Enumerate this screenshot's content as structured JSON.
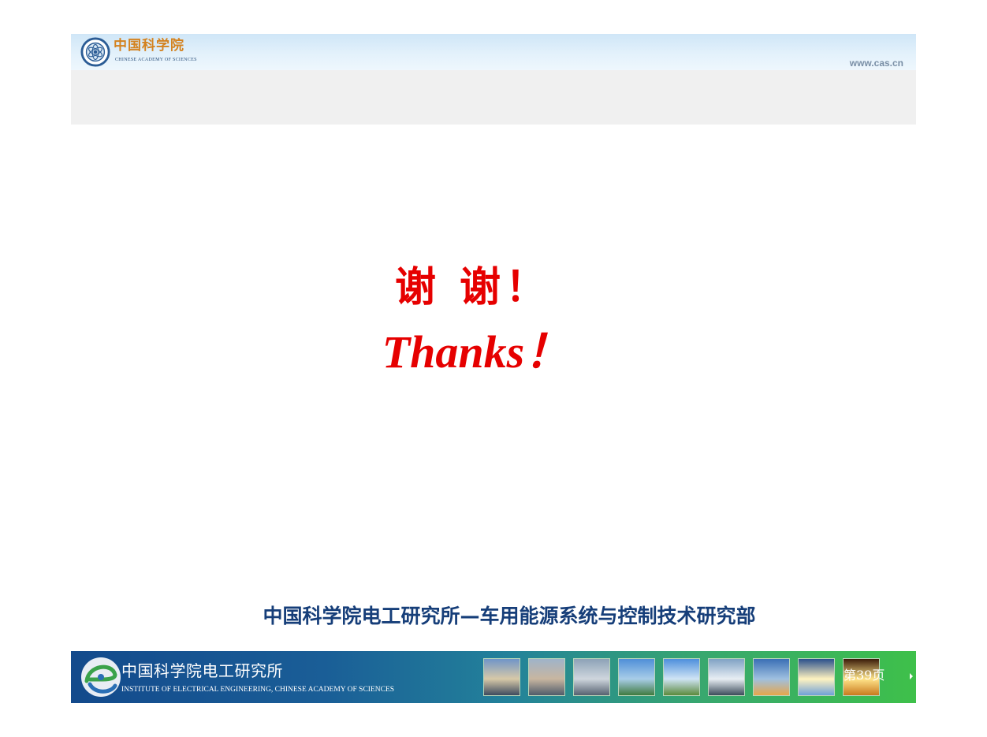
{
  "header": {
    "org_name_cn": "中国科学院",
    "org_name_en": "CHINESE ACADEMY OF SCIENCES",
    "url": "www.cas.cn"
  },
  "slide": {
    "thanks_cn": "谢 谢！",
    "thanks_en": "Thanks！"
  },
  "department": "中国科学院电工研究所—车用能源系统与控制技术研究部",
  "footer": {
    "institute_cn": "中国科学院电工研究所",
    "institute_en": "INSTITUTE OF ELECTRICAL ENGINEERING, CHINESE ACADEMY OF SCIENCES",
    "page_label": "第39页",
    "thumbnails": [
      {
        "name": "bridge-photo",
        "colors": [
          "#6f95c8",
          "#d7c9a8",
          "#3d4a5e"
        ]
      },
      {
        "name": "stadium-photo",
        "colors": [
          "#9fb3c9",
          "#c8b6a0",
          "#4f5b6a"
        ]
      },
      {
        "name": "solar-array-photo",
        "colors": [
          "#8da2b7",
          "#cfd6dd",
          "#556170"
        ]
      },
      {
        "name": "transmission-lines-photo",
        "colors": [
          "#4f8fd8",
          "#a8cde8",
          "#3f7a3f"
        ]
      },
      {
        "name": "wind-turbines-photo",
        "colors": [
          "#4d8fdc",
          "#cfe4f5",
          "#5b8a3c"
        ]
      },
      {
        "name": "dam-photo",
        "colors": [
          "#7fa2c4",
          "#e8eef4",
          "#3c4b5a"
        ]
      },
      {
        "name": "satellite-dish-photo",
        "colors": [
          "#3a6fb5",
          "#9fc0e0",
          "#e7a64a"
        ]
      },
      {
        "name": "light-burst-photo",
        "colors": [
          "#2a4f8c",
          "#fff3c0",
          "#6fa0d8"
        ]
      },
      {
        "name": "fireworks-photo",
        "colors": [
          "#3a1a08",
          "#ffe48a",
          "#c97a1e"
        ]
      }
    ]
  },
  "colors": {
    "accent_red": "#e60000",
    "dept_blue": "#163e79",
    "cas_orange": "#d4821f"
  }
}
